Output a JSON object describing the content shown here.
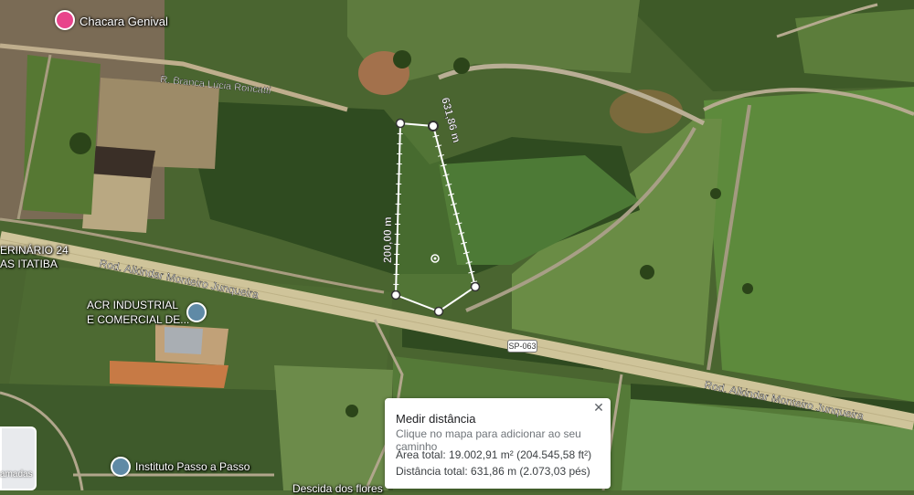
{
  "places": {
    "chacara": "Chacara Genival",
    "acr_line1": "ACR INDUSTRIAL",
    "acr_line2": "E COMERCIAL DE...",
    "instituto": "Instituto Passo a Passo",
    "left_partial_1": "ERINÁRIO 24",
    "left_partial_2": "AS ITATIBA",
    "bottom_partial": "Descida dos flores"
  },
  "roads": {
    "rua_branca": "R. Branca Lúcia Roncatti",
    "rod_upper": "Rod. Alkindar Monteiro Junqueira",
    "rod_lower": "Rod. Alkindar Monteiro Junqueira",
    "shield": "SP-063"
  },
  "measure": {
    "segment_top": "631,86 m",
    "segment_left": "200,00 m",
    "color": "#ffffff"
  },
  "panel": {
    "title": "Medir distância",
    "hint": "Clique no mapa para adicionar ao seu caminho",
    "area": "Área total: 19.002,91 m² (204.545,58 ft²)",
    "distance": "Distância total: 631,86 m (2.073,03 pés)"
  },
  "thumbnail": {
    "label": "amadas"
  },
  "colors": {
    "chacara_pin": "#e8448b",
    "generic_pin": "#5f8aa6"
  }
}
